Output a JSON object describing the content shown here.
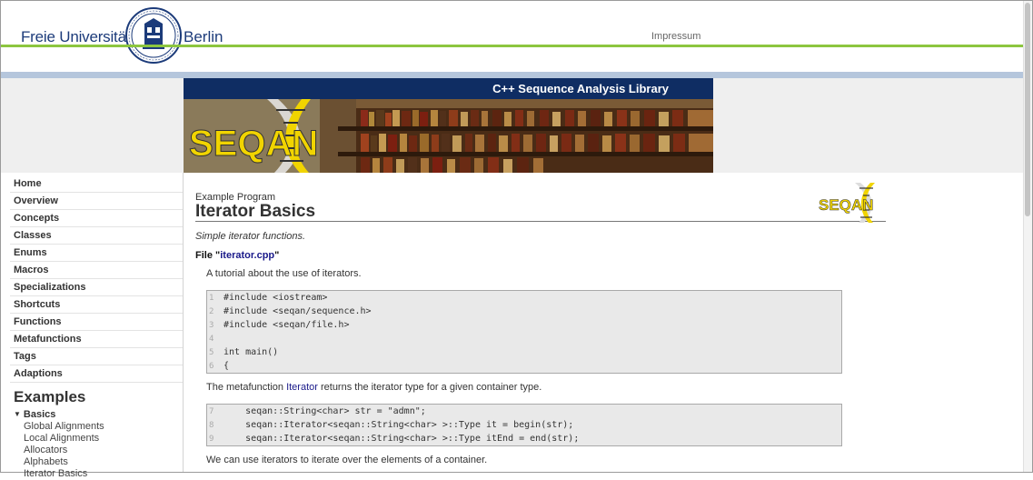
{
  "header": {
    "university_left": "Freie Universität",
    "university_right": "Berlin",
    "impressum": "Impressum"
  },
  "banner": {
    "title": "C++ Sequence Analysis Library",
    "logo_text": "SEQAN"
  },
  "sidebar": {
    "items": [
      {
        "label": "Home"
      },
      {
        "label": "Overview"
      },
      {
        "label": "Concepts"
      },
      {
        "label": "Classes"
      },
      {
        "label": "Enums"
      },
      {
        "label": "Macros"
      },
      {
        "label": "Specializations"
      },
      {
        "label": "Shortcuts"
      },
      {
        "label": "Functions"
      },
      {
        "label": "Metafunctions"
      },
      {
        "label": "Tags"
      },
      {
        "label": "Adaptions"
      }
    ],
    "examples_heading": "Examples",
    "basics_label": "Basics",
    "sub_items": [
      {
        "label": "Global Alignments"
      },
      {
        "label": "Local Alignments"
      },
      {
        "label": "Allocators"
      },
      {
        "label": "Alphabets"
      },
      {
        "label": "Iterator Basics"
      }
    ]
  },
  "main": {
    "kicker": "Example Program",
    "title": "Iterator Basics",
    "subtitle": "Simple iterator functions.",
    "file_prefix": "File \"",
    "file_name": "iterator.cpp",
    "file_suffix": "\"",
    "para1": "A tutorial about the use of iterators.",
    "code1": [
      {
        "num": "1",
        "text": "#include <iostream>"
      },
      {
        "num": "2",
        "text": "#include <seqan/sequence.h>"
      },
      {
        "num": "3",
        "text": "#include <seqan/file.h>"
      },
      {
        "num": "4",
        "text": ""
      },
      {
        "num": "5",
        "text": "int main()"
      },
      {
        "num": "6",
        "text": "{"
      }
    ],
    "para2_before": "The metafunction ",
    "para2_link": "Iterator",
    "para2_after": " returns the iterator type for a given container type.",
    "code2": [
      {
        "num": "7",
        "text": "    seqan::String<char> str = \"admn\";"
      },
      {
        "num": "8",
        "text": "    seqan::Iterator<seqan::String<char> >::Type it = begin(str);"
      },
      {
        "num": "9",
        "text": "    seqan::Iterator<seqan::String<char> >::Type itEnd = end(str);"
      }
    ],
    "para3": "We can use iterators to iterate over the elements of a container."
  }
}
